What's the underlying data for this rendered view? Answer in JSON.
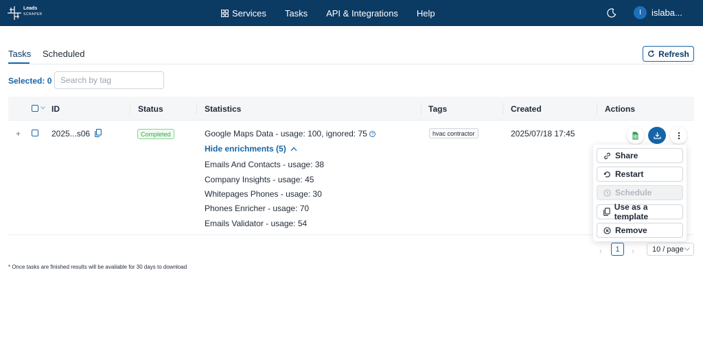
{
  "navbar": {
    "logo_line1": "Leads",
    "logo_line2": "SCRAPER",
    "links": [
      {
        "label": "Services",
        "icon": "grid-icon"
      },
      {
        "label": "Tasks"
      },
      {
        "label": "API & Integrations"
      },
      {
        "label": "Help"
      }
    ],
    "user_initial": "I",
    "username": "islaba..."
  },
  "tabs": [
    {
      "label": "Tasks",
      "active": true
    },
    {
      "label": "Scheduled",
      "active": false
    }
  ],
  "refresh_label": "Refresh",
  "selected_label": "Selected: 0",
  "search": {
    "placeholder": "Search by tag",
    "value": ""
  },
  "table": {
    "columns": [
      "ID",
      "Status",
      "Statistics",
      "Tags",
      "Created",
      "Actions"
    ],
    "row": {
      "id": "2025...s06",
      "status": "Completed",
      "statistics": {
        "main": "Google Maps Data - usage: 100, ignored: 75",
        "toggle_label": "Hide enrichments (5)",
        "enrichments": [
          "Emails And Contacts - usage: 38",
          "Company Insights - usage: 45",
          "Whitepages Phones - usage: 30",
          "Phones Enricher - usage: 70",
          "Emails Validator - usage: 54"
        ]
      },
      "tag": "hvac contractor",
      "created": "2025/07/18 17:45"
    }
  },
  "actions_menu": [
    {
      "label": "Share",
      "icon": "link-icon",
      "disabled": false
    },
    {
      "label": "Restart",
      "icon": "restart-icon",
      "disabled": false
    },
    {
      "label": "Schedule",
      "icon": "clock-icon",
      "disabled": true
    },
    {
      "label": "Use as a template",
      "icon": "copy-icon",
      "disabled": false
    },
    {
      "label": "Remove",
      "icon": "remove-icon",
      "disabled": false
    }
  ],
  "pagination": {
    "current_page": "1",
    "page_size": "10 / page"
  },
  "footnote": "* Once tasks are finished results will be available for 30 days to download",
  "colors": {
    "navbar": "#0b3a63",
    "accent": "#1565a8",
    "status_green": "#3aa34b"
  }
}
